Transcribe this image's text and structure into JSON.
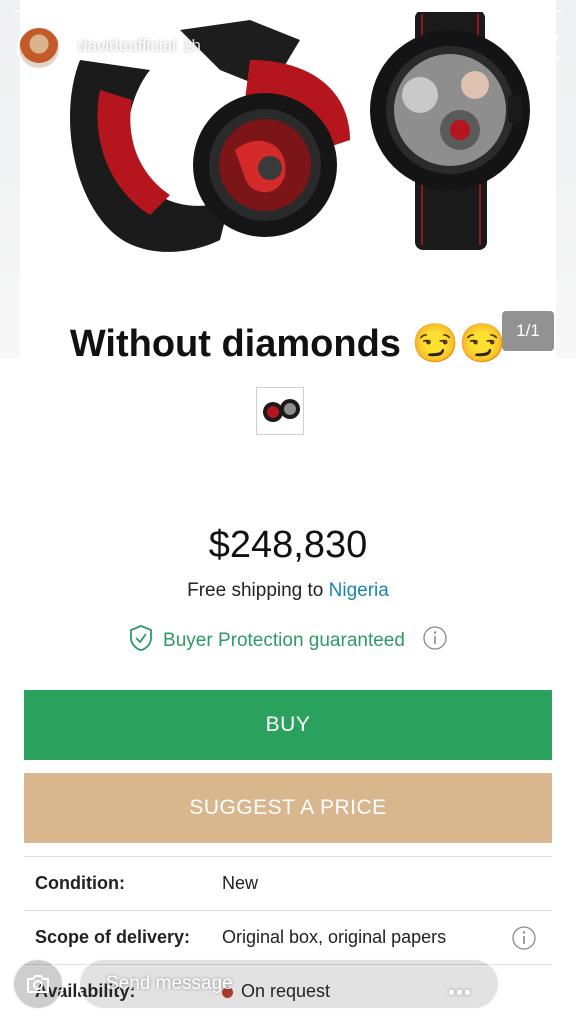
{
  "story": {
    "username": "davidoofficial",
    "time": "1h",
    "progress": 1.0
  },
  "product": {
    "image_counter": "1/1",
    "price": "$248,830",
    "shipping_prefix": "Free shipping to ",
    "shipping_country": "Nigeria",
    "buyer_protection": "Buyer Protection guaranteed"
  },
  "caption": "Without diamonds 😏😏",
  "buttons": {
    "buy": "BUY",
    "suggest": "SUGGEST A PRICE"
  },
  "details": [
    {
      "label": "Condition:",
      "value": "New"
    },
    {
      "label": "Scope of delivery:",
      "value": "Original box, original papers"
    },
    {
      "label": "Availability:",
      "value": "On request"
    }
  ],
  "reply": {
    "placeholder": "Send message"
  },
  "colors": {
    "buy": "#2aa25e",
    "suggest": "#d8b78e",
    "link": "#1a85b5",
    "protection": "#2d9b63"
  },
  "icons": {
    "close": "close-icon",
    "shield": "shield-check-icon",
    "info": "info-icon",
    "camera": "camera-icon",
    "more": "more-icon",
    "send": "send-icon"
  }
}
